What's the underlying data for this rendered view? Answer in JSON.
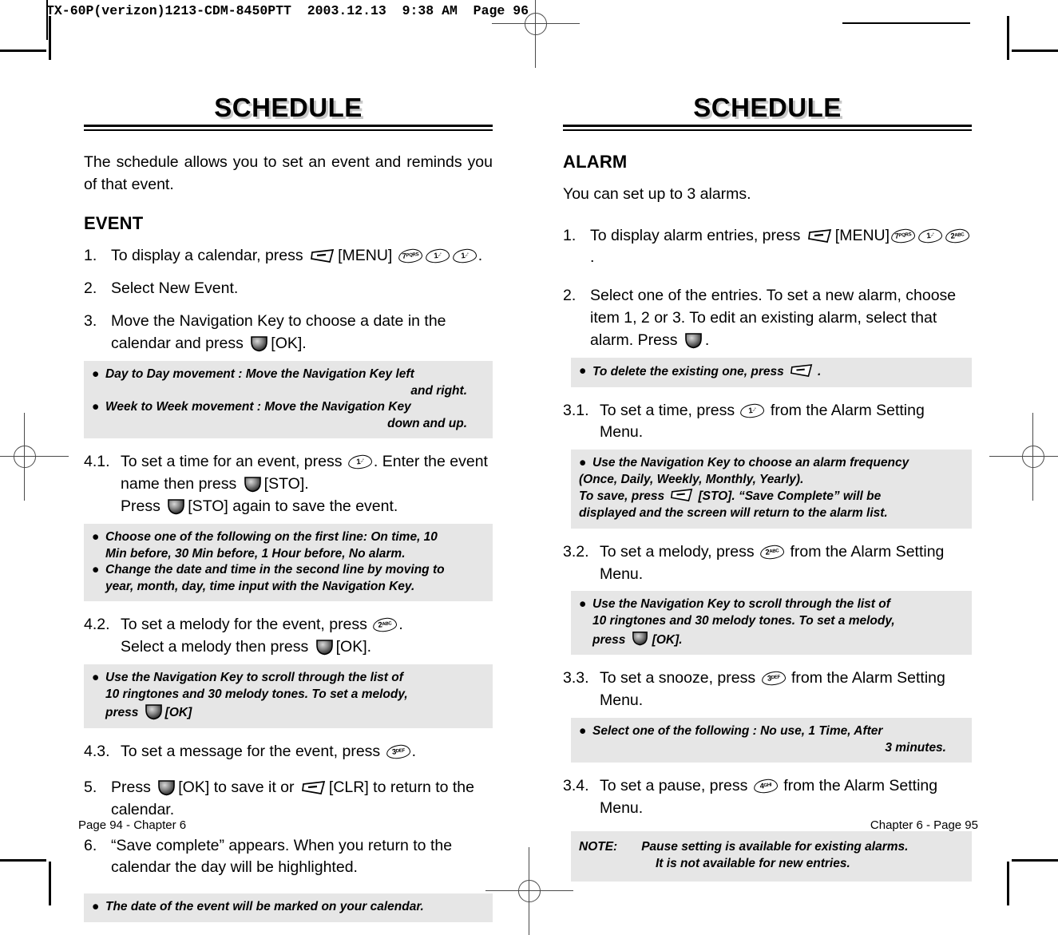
{
  "print_marks": {
    "slug": "TX-60P(verizon)1213-CDM-8450PTT  2003.12.13  9:38 AM  Page 96"
  },
  "left_page": {
    "section_title": "SCHEDULE",
    "intro": "The schedule allows you to set an event and reminds you of that event.",
    "subheading": "EVENT",
    "steps": [
      {
        "num": "1.",
        "text_a": "To display a calendar, press ",
        "text_b": "[MENU] ",
        "text_c": "."
      },
      {
        "num": "2.",
        "text": "Select New Event."
      },
      {
        "num": "3.",
        "text_a": "Move the Navigation Key to choose a date in the calendar and press ",
        "text_b": "[OK]."
      },
      {
        "num": "4.1.",
        "text_a": "To set a time for an event, press ",
        "text_b": ". Enter the event name then press ",
        "text_c": "[STO].",
        "text_d": "Press ",
        "text_e": "[STO] again to save the event."
      },
      {
        "num": "4.2.",
        "text_a": "To set a melody for the event, press ",
        "text_b": ".",
        "text_c": "Select a melody then press ",
        "text_d": "[OK]."
      },
      {
        "num": "4.3.",
        "text_a": "To set a message for the event, press ",
        "text_b": "."
      },
      {
        "num": "5.",
        "text_a": "Press ",
        "text_b": "[OK] to save it or ",
        "text_c": "[CLR] to return to the calendar."
      },
      {
        "num": "6.",
        "text": "“Save complete” appears. When you return to the calendar the day will be highlighted."
      }
    ],
    "box_navigation": {
      "line1": "Day to Day movement : Move the Navigation Key left",
      "line1b": "and right.",
      "line2": "Week to Week movement : Move the Navigation Key",
      "line2b": "down and up."
    },
    "box_alarm_choice": {
      "line1": "Choose one of the following on the first line: On time, 10",
      "line1b": "Min before, 30 Min before, 1 Hour before, No alarm.",
      "line2": "Change the date and time in the second line by moving to",
      "line2b": "year, month, day, time input with the Navigation Key."
    },
    "box_melody": {
      "line1": "Use the Navigation Key to scroll through the list of",
      "line1b": "10 ringtones and 30 melody tones. To set a melody,",
      "line1c": "press ",
      "line1d": "[OK]"
    },
    "box_marked": {
      "line1": "The date of the event will be marked on your calendar."
    },
    "footer": "Page 94 - Chapter 6"
  },
  "right_page": {
    "section_title": "SCHEDULE",
    "subheading": "ALARM",
    "intro": "You can set up to 3 alarms.",
    "steps": [
      {
        "num": "1.",
        "text_a": "To display alarm entries, press ",
        "text_b": "[MENU]",
        "text_c": "."
      },
      {
        "num": "2.",
        "text_a": "Select one of the entries. To set a new alarm, choose item 1, 2 or 3. To edit an existing alarm, select that alarm. Press ",
        "text_b": "."
      },
      {
        "num": "3.1.",
        "text_a": "To set a time, press ",
        "text_b": " from the Alarm Setting Menu."
      },
      {
        "num": "3.2.",
        "text_a": "To set a melody, press ",
        "text_b": " from the Alarm Setting Menu."
      },
      {
        "num": "3.3.",
        "text_a": "To set a snooze, press ",
        "text_b": " from the Alarm Setting Menu."
      },
      {
        "num": "3.4.",
        "text_a": "To set a pause, press ",
        "text_b": " from the Alarm Setting Menu."
      }
    ],
    "box_delete": {
      "line1a": "To delete the existing one, press ",
      "line1b": "."
    },
    "box_frequency": {
      "line1": "Use the Navigation Key to choose an alarm frequency",
      "line2": "(Once, Daily, Weekly, Monthly, Yearly).",
      "line3a": "To save, press ",
      "line3b": "[STO]. “Save Complete” will be",
      "line4": "displayed and the screen will return to the alarm list."
    },
    "box_melody": {
      "line1": "Use the Navigation Key to scroll through the list of",
      "line2": "10 ringtones and 30 melody tones. To set a melody,",
      "line3a": "press ",
      "line3b": "[OK]."
    },
    "box_snooze": {
      "line1": "Select one of the following : No use, 1 Time, After",
      "line2": "3 minutes."
    },
    "box_note": {
      "label": "NOTE:",
      "line1": "Pause setting is available for existing alarms.",
      "line2": "It is not available for new entries."
    },
    "footer": "Chapter 6 - Page 95"
  },
  "keys": {
    "k1": "1",
    "k1sup": ".-ʹ",
    "k2": "2",
    "k2sup": "ABC",
    "k3": "3",
    "k3sup": "DEF",
    "k4": "4",
    "k4sup": "GHI",
    "k7": "7",
    "k7sup": "PQRS"
  }
}
